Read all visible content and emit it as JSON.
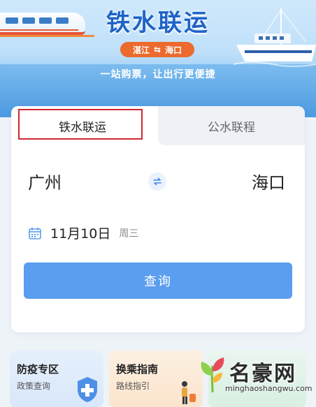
{
  "banner": {
    "title": "铁水联运",
    "route_from": "湛江",
    "route_to": "海口",
    "slogan": "一站购票，让出行更便捷"
  },
  "tabs": [
    {
      "label": "铁水联运",
      "active": true
    },
    {
      "label": "公水联程",
      "active": false
    }
  ],
  "trip": {
    "from_city": "广州",
    "to_city": "海口",
    "date": "11月10日",
    "weekday": "周三"
  },
  "query_button": "查询",
  "services": [
    {
      "title": "防疫专区",
      "subtitle": "政策查询"
    },
    {
      "title": "换乘指南",
      "subtitle": "路线指引"
    }
  ],
  "watermark": {
    "name": "名豪网",
    "url": "minghaoshangwu.com"
  },
  "colors": {
    "accent": "#5b9def",
    "title_blue": "#1f63c6",
    "route_pill": "#ec6a2e",
    "highlight_border": "#d0262f"
  }
}
